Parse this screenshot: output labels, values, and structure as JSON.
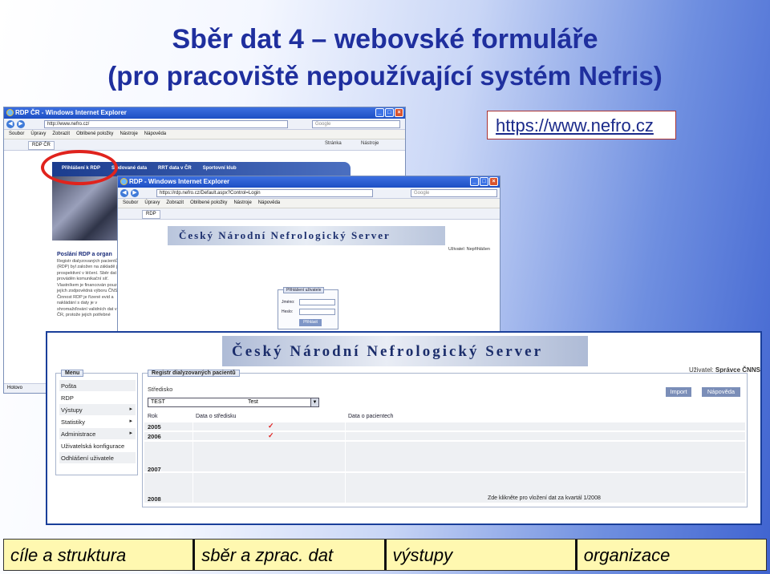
{
  "slide": {
    "title_line1": "Sběr dat 4 – webovské formuláře",
    "title_line2": "(pro pracoviště nepoužívající systém Nefris)",
    "url": "https://www.nefro.cz"
  },
  "browser1": {
    "window_title": "RDP ČR - Windows Internet Explorer",
    "address": "http://www.nefro.cz/",
    "search_placeholder": "Google",
    "menu": [
      "Soubor",
      "Úpravy",
      "Zobrazit",
      "Oblíbené položky",
      "Nástroje",
      "Nápověda"
    ],
    "tab": "RDP ČR",
    "tools_page": "Stránka",
    "tools_tools": "Nástroje",
    "nav": [
      "Přihlášení k RDP",
      "Sledované data",
      "RRT data v ČR",
      "Sportovní klub"
    ],
    "content_heading": "Poslání RDP a organ",
    "content_text": "Registr dialyzovaných pacientů (RDP) byl založen na základě je prospektivní v léčení. Sběr dat je prováděn komunikační síť. Vlastníkem je financován pouze z jejích zodpovědná výboru ČNS. Činnost RDP je řízené evid a nakládání s daty je v shromažďování validních dat v ČR, protože jejich potřebné",
    "status": "Hotovo"
  },
  "browser2": {
    "window_title": "RDP - Windows Internet Explorer",
    "address": "https://rdp.nefro.cz/Default.aspx?Control=Login",
    "search_text": "Google",
    "menu": [
      "Soubor",
      "Úpravy",
      "Zobrazit",
      "Oblíbené položky",
      "Nástroje",
      "Nápověda"
    ],
    "tab": "RDP",
    "banner": "Český Národní Nefrologický Server",
    "user": "Uživatel: Nepřihlášen",
    "login_title": "Přihlášení uživatele",
    "login_name_label": "Jméno:",
    "login_pass_label": "Heslo:",
    "login_button": "Přihlásit"
  },
  "app": {
    "banner": "Český Národní Nefrologický Server",
    "user_label": "Uživatel:",
    "user_name": "Správce ČNNS",
    "menu_title": "Menu",
    "menu_items": [
      {
        "label": "Pošta",
        "arrow": ""
      },
      {
        "label": "RDP",
        "arrow": ""
      },
      {
        "label": "Výstupy",
        "arrow": "▸"
      },
      {
        "label": "Statistiky",
        "arrow": "▸"
      },
      {
        "label": "Administrace",
        "arrow": "▸"
      },
      {
        "label": "Uživatelská konfigurace",
        "arrow": ""
      },
      {
        "label": "Odhlášení uživatele",
        "arrow": ""
      }
    ],
    "register_title": "Registr dialyzovaných pacientů",
    "stredisko_label": "Středisko",
    "stredisko_code": "TEST",
    "stredisko_name": "Test",
    "import_button": "Import",
    "help_button": "Nápověda",
    "col_year": "Rok",
    "col_center": "Data o středisku",
    "col_patients": "Data o pacientech",
    "rows": [
      {
        "year": "2005",
        "center": "✓",
        "patients": ""
      },
      {
        "year": "2006",
        "center": "✓",
        "patients": ""
      },
      {
        "year": "2007",
        "center": "",
        "patients": "✓"
      },
      {
        "year": "2008",
        "center": "",
        "patients": ""
      }
    ],
    "row_note": "Zde klikněte pro vložení dat za kvartál 1/2008"
  },
  "bottom_nav": [
    "cíle a struktura",
    "sběr a zprac. dat",
    "výstupy",
    "organizace"
  ]
}
